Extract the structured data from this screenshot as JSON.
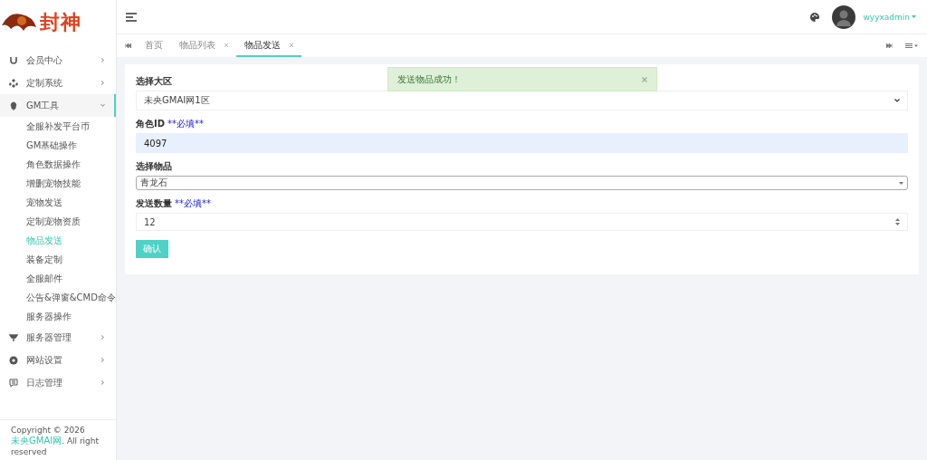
{
  "sidebar": {
    "logo_text": "封神",
    "menu": [
      {
        "label": "会员中心",
        "expanded": false
      },
      {
        "label": "定制系统",
        "expanded": false
      },
      {
        "label": "GM工具",
        "expanded": true,
        "children": [
          {
            "label": "全服补发平台币",
            "selected": false
          },
          {
            "label": "GM基础操作",
            "selected": false
          },
          {
            "label": "角色数据操作",
            "selected": false
          },
          {
            "label": "增删宠物技能",
            "selected": false
          },
          {
            "label": "宠物发送",
            "selected": false
          },
          {
            "label": "定制宠物资质",
            "selected": false
          },
          {
            "label": "物品发送",
            "selected": true
          },
          {
            "label": "装备定制",
            "selected": false
          },
          {
            "label": "全服邮件",
            "selected": false
          },
          {
            "label": "公告&弹窗&CMD命令",
            "selected": false
          },
          {
            "label": "服务器操作",
            "selected": false
          }
        ]
      },
      {
        "label": "服务器管理",
        "expanded": false
      },
      {
        "label": "网站设置",
        "expanded": false
      },
      {
        "label": "日志管理",
        "expanded": false
      }
    ],
    "footer": {
      "text": "Copyright © 2026",
      "link": "未央GMAI网",
      "rest": ". All right reserved"
    }
  },
  "header": {
    "user": "wyyxadmin"
  },
  "tabs": [
    {
      "label": "首页",
      "closable": false,
      "selected": false
    },
    {
      "label": "物品列表",
      "closable": true,
      "selected": false
    },
    {
      "label": "物品发送",
      "closable": true,
      "selected": true
    }
  ],
  "toast": {
    "message": "发送物品成功！"
  },
  "form": {
    "fields": [
      {
        "kind": "select",
        "label": "选择大区",
        "value": "未央GMAI网1区"
      },
      {
        "kind": "text",
        "label": "角色ID",
        "note": "**必填**",
        "value": "4097"
      },
      {
        "kind": "combo",
        "label": "选择物品",
        "value": "青龙石"
      },
      {
        "kind": "number",
        "label": "发送数量",
        "note": "**必填**",
        "value": "12"
      }
    ],
    "submit": "确认"
  }
}
